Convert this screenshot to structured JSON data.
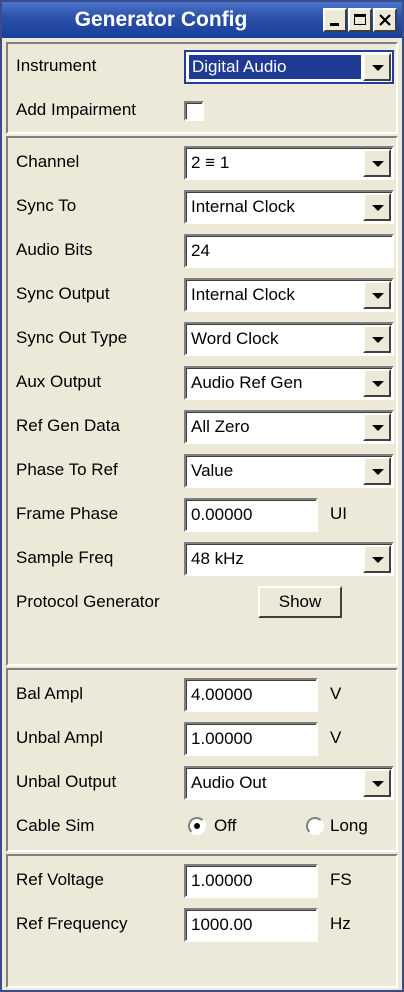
{
  "window": {
    "title": "Generator Config"
  },
  "instrument": {
    "label": "Instrument",
    "value": "Digital Audio"
  },
  "add_impairment": {
    "label": "Add Impairment",
    "checked": false
  },
  "channel": {
    "label": "Channel",
    "value": "2 ≡ 1"
  },
  "sync_to": {
    "label": "Sync To",
    "value": "Internal Clock"
  },
  "audio_bits": {
    "label": "Audio Bits",
    "value": "24"
  },
  "sync_output": {
    "label": "Sync Output",
    "value": "Internal Clock"
  },
  "sync_out_type": {
    "label": "Sync Out Type",
    "value": "Word Clock"
  },
  "aux_output": {
    "label": "Aux Output",
    "value": "Audio Ref Gen"
  },
  "ref_gen_data": {
    "label": "Ref Gen Data",
    "value": "All Zero"
  },
  "phase_to_ref": {
    "label": "Phase To Ref",
    "value": "Value"
  },
  "frame_phase": {
    "label": "Frame Phase",
    "value": "0.00000",
    "unit": "UI"
  },
  "sample_freq": {
    "label": "Sample Freq",
    "value": "48 kHz"
  },
  "protocol_generator": {
    "label": "Protocol Generator",
    "button": "Show"
  },
  "bal_ampl": {
    "label": "Bal Ampl",
    "value": "4.00000",
    "unit": "V"
  },
  "unbal_ampl": {
    "label": "Unbal Ampl",
    "value": "1.00000",
    "unit": "V"
  },
  "unbal_output": {
    "label": "Unbal Output",
    "value": "Audio Out"
  },
  "cable_sim": {
    "label": "Cable Sim",
    "options": [
      "Off",
      "Long"
    ],
    "selected": "Off"
  },
  "ref_voltage": {
    "label": "Ref Voltage",
    "value": "1.00000",
    "unit": "FS"
  },
  "ref_frequency": {
    "label": "Ref Frequency",
    "value": "1000.00",
    "unit": "Hz"
  },
  "colors": {
    "titlebar": "#2a4fa8",
    "face": "#ece9d8",
    "highlight": "#1f3a93"
  }
}
